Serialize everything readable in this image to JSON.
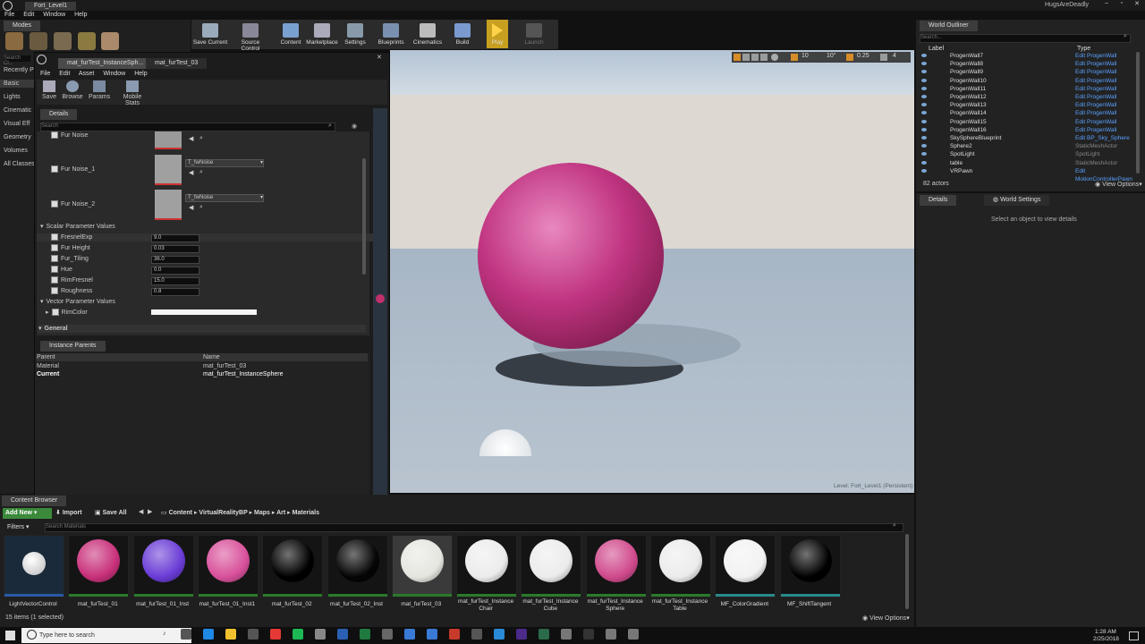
{
  "app": {
    "title": "Fort_Level1",
    "user": "HugsAreDeadly"
  },
  "menubar": [
    "File",
    "Edit",
    "Window",
    "Help"
  ],
  "modes": {
    "tab": "Modes",
    "search_placeholder": "Search Cl...",
    "categories": [
      "Recently P",
      "Basic",
      "Lights",
      "Cinematic",
      "Visual Eff",
      "Geometry",
      "Volumes",
      "All Classes"
    ]
  },
  "toolbar": [
    {
      "label": "Save Current",
      "icon": "save-icon"
    },
    {
      "label": "Source Control",
      "icon": "source-control-icon"
    },
    {
      "label": "Content",
      "icon": "content-icon"
    },
    {
      "label": "Marketplace",
      "icon": "marketplace-icon"
    },
    {
      "label": "Settings",
      "icon": "settings-icon"
    },
    {
      "label": "Blueprints",
      "icon": "blueprints-icon"
    },
    {
      "label": "Cinematics",
      "icon": "cinematics-icon"
    },
    {
      "label": "Build",
      "icon": "build-icon"
    },
    {
      "label": "Play",
      "icon": "play-icon"
    },
    {
      "label": "Launch",
      "icon": "launch-icon"
    }
  ],
  "material_editor": {
    "tabs": [
      "mat_furTest_InstanceSph...",
      "mat_furTest_03"
    ],
    "menu": [
      "File",
      "Edit",
      "Asset",
      "Window",
      "Help"
    ],
    "toolbar": [
      "Save",
      "Browse",
      "Params",
      "Mobile Stats"
    ],
    "details_tab": "Details",
    "search_placeholder": "Search",
    "textures": [
      {
        "label": "Fur Noise",
        "value": ""
      },
      {
        "label": "Fur Noise_1",
        "value": "T_fwNoise"
      },
      {
        "label": "Fur Noise_2",
        "value": "T_fwNoise"
      }
    ],
    "scalar_header": "Scalar Parameter Values",
    "scalars": [
      {
        "label": "FresnelExp",
        "value": "9.0"
      },
      {
        "label": "Fur Height",
        "value": "0.03"
      },
      {
        "label": "Fur_Tiling",
        "value": "36.0"
      },
      {
        "label": "Hue",
        "value": "0.0"
      },
      {
        "label": "RimFresnel",
        "value": "15.0"
      },
      {
        "label": "Roughness",
        "value": "0.8"
      }
    ],
    "vector_header": "Vector Parameter Values",
    "vector": {
      "label": "RimColor"
    },
    "general": "General",
    "instance_parents": {
      "tab": "Instance Parents",
      "headers": [
        "Parent",
        "Name"
      ],
      "rows": [
        [
          "Material",
          "mat_furTest_03"
        ],
        [
          "Current",
          "mat_furTest_InstanceSphere"
        ]
      ]
    }
  },
  "viewport": {
    "toolbar_values": [
      "10",
      "10°",
      "0.25",
      "4"
    ],
    "level_label": "Level: Fort_Level1 (Persistent)"
  },
  "outliner": {
    "tab": "World Outliner",
    "search_placeholder": "Search...",
    "headers": [
      "Label",
      "Type"
    ],
    "rows": [
      {
        "label": "ProgenWall7",
        "type": "Edit ProgenWall"
      },
      {
        "label": "ProgenWall8",
        "type": "Edit ProgenWall"
      },
      {
        "label": "ProgenWall9",
        "type": "Edit ProgenWall"
      },
      {
        "label": "ProgenWall10",
        "type": "Edit ProgenWall"
      },
      {
        "label": "ProgenWall11",
        "type": "Edit ProgenWall"
      },
      {
        "label": "ProgenWall12",
        "type": "Edit ProgenWall"
      },
      {
        "label": "ProgenWall13",
        "type": "Edit ProgenWall"
      },
      {
        "label": "ProgenWall14",
        "type": "Edit ProgenWall"
      },
      {
        "label": "ProgenWall15",
        "type": "Edit ProgenWall"
      },
      {
        "label": "ProgenWall16",
        "type": "Edit ProgenWall"
      },
      {
        "label": "SkySphereBlueprint",
        "type": "Edit BP_Sky_Sphere"
      },
      {
        "label": "Sphere2",
        "type": "StaticMeshActor"
      },
      {
        "label": "SpotLight",
        "type": "SpotLight"
      },
      {
        "label": "table",
        "type": "StaticMeshActor"
      },
      {
        "label": "VRPawn",
        "type": "Edit MotionControllerPawn"
      }
    ],
    "count": "82 actors",
    "view_options": "View Options"
  },
  "details": {
    "tabs": [
      "Details",
      "World Settings"
    ],
    "empty": "Select an object to view details"
  },
  "content_browser": {
    "tab": "Content Browser",
    "add_new": "Add New",
    "import": "Import",
    "save_all": "Save All",
    "path": [
      "Content",
      "VirtualRealityBP",
      "Maps",
      "Art",
      "Materials"
    ],
    "filters": "Filters",
    "search_placeholder": "Search Materials",
    "assets": [
      {
        "name": "LightVectorControl",
        "color": "#e8e8e8"
      },
      {
        "name": "mat_furTest_01",
        "color": "#c8307a"
      },
      {
        "name": "mat_furTest_01_Inst",
        "color": "#6a3cd6"
      },
      {
        "name": "mat_furTest_01_Inst1",
        "color": "#d8509a"
      },
      {
        "name": "mat_furTest_02",
        "color": "#000000"
      },
      {
        "name": "mat_furTest_02_Inst",
        "color": "#050505"
      },
      {
        "name": "mat_furTest_03",
        "color": "#e6e6e0"
      },
      {
        "name": "mat_furTest_Instance Chair",
        "color": "#ececec"
      },
      {
        "name": "mat_furTest_Instance Cube",
        "color": "#ececec"
      },
      {
        "name": "mat_furTest_Instance Sphere",
        "color": "#d04a8c"
      },
      {
        "name": "mat_furTest_Instance Table",
        "color": "#ececec"
      },
      {
        "name": "MF_ColorGradient",
        "color": "#f2f2f2"
      },
      {
        "name": "MF_ShiftTangent",
        "color": "#000000"
      }
    ],
    "status": "15 items (1 selected)",
    "view_options": "View Options"
  },
  "taskbar": {
    "search_placeholder": "Type here to search",
    "time": "1:28 AM",
    "date": "2/25/2018"
  }
}
